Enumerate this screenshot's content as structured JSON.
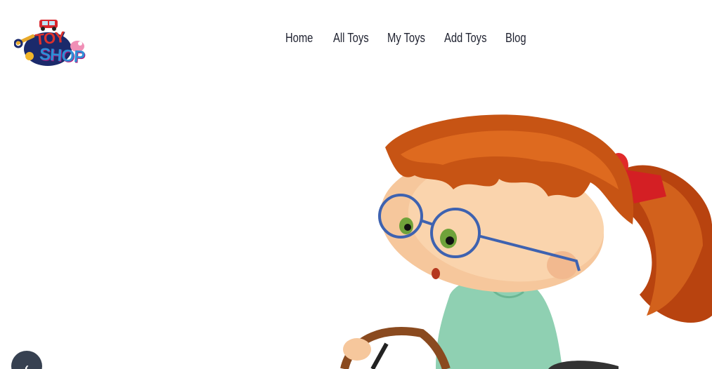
{
  "logo": {
    "line1": "TOY",
    "line2": "SHOP"
  },
  "nav": {
    "items": [
      {
        "label": "Home"
      },
      {
        "label": "All Toys"
      },
      {
        "label": "My Toys"
      },
      {
        "label": "Add Toys"
      },
      {
        "label": "Blog"
      }
    ]
  },
  "hero": {
    "image": "girl-driving-toy-car-illustration"
  },
  "slider": {
    "prev_icon": "chevron-left-icon",
    "prev_glyph": "‹"
  }
}
